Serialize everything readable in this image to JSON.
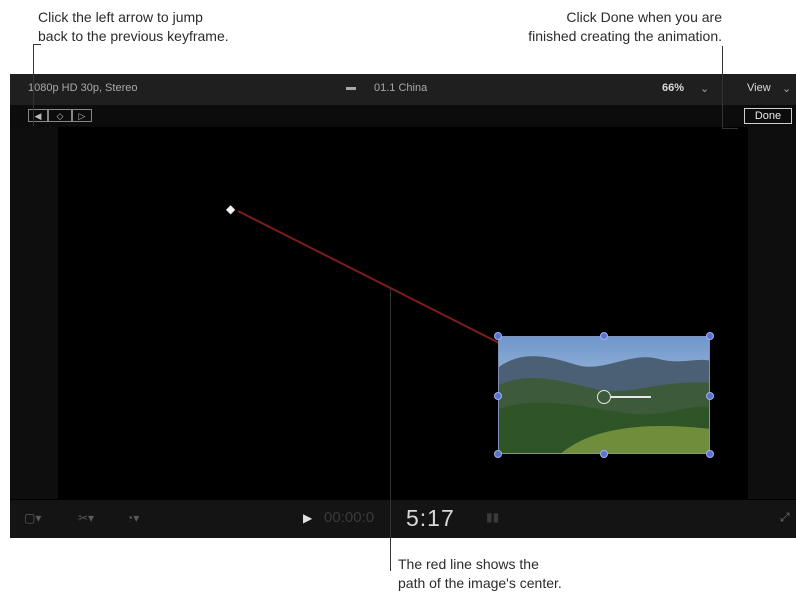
{
  "callouts": {
    "left": [
      "Click the left arrow to jump",
      "back to the previous keyframe."
    ],
    "right": [
      "Click Done when you are",
      "finished creating the animation."
    ],
    "bottom": [
      "The red line shows the",
      "path of the image's center."
    ]
  },
  "viewer": {
    "format": "1080p HD 30p, Stereo",
    "project": "01.1 China",
    "zoom": "66%",
    "view_menu": "View",
    "done_label": "Done",
    "timecode": "5:17",
    "keyframe_nav": [
      "previous-keyframe",
      "add-keyframe",
      "next-keyframe"
    ]
  },
  "colors": {
    "motion_path": "#7a1d1d",
    "viewer_bg": "#000000",
    "handle": "#5a72d0"
  }
}
